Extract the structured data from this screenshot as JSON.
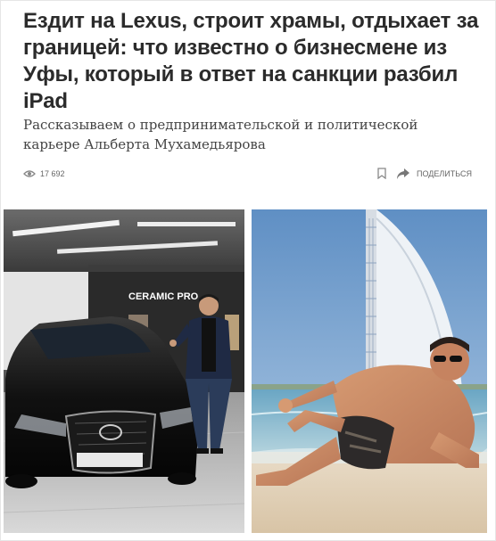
{
  "article": {
    "title": "Ездит на Lexus, строит храмы, отдыхает за границей: что известно о бизнесмене из Уфы, который в ответ на санкции разбил iPad",
    "lead": "Рассказываем о предпринимательской и политической карьере Альберта Мухамедьярова",
    "views": "17 692",
    "share_label": "ПОДЕЛИТЬСЯ"
  },
  "photos": {
    "left": {
      "sign_text": "CERAMIC PRO"
    },
    "right": {}
  },
  "icons": {
    "views": "eye-icon",
    "bookmark": "bookmark-icon",
    "share": "share-arrow-icon"
  }
}
